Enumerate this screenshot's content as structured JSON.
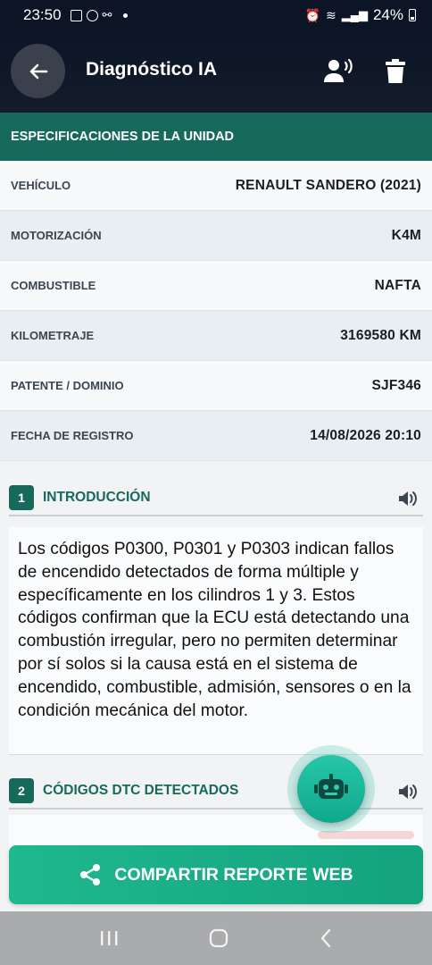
{
  "status_bar": {
    "time": "23:50",
    "battery": "24%"
  },
  "app_bar": {
    "title": "Diagnóstico IA",
    "icons": [
      "arrow-back-icon",
      "voice-person-icon",
      "trash-icon"
    ]
  },
  "specs": {
    "header": "ESPECIFICACIONES DE LA UNIDAD",
    "rows": [
      {
        "label": "VEHÍCULO",
        "value": "RENAULT SANDERO (2021)"
      },
      {
        "label": "MOTORIZACIÓN",
        "value": "K4M"
      },
      {
        "label": "COMBUSTIBLE",
        "value": "NAFTA"
      },
      {
        "label": "KILOMETRAJE",
        "value": "3169580 KM"
      },
      {
        "label": "PATENTE / DOMINIO",
        "value": "SJF346"
      },
      {
        "label": "FECHA DE REGISTRO",
        "value": "14/08/2026 20:10"
      }
    ]
  },
  "sections": [
    {
      "number": "1",
      "title": "INTRODUCCIÓN",
      "body": "Los códigos P0300, P0301 y P0303 indican fallos de encendido detectados de forma múltiple y específicamente en los cilindros 1 y 3. Estos códigos confirman que la ECU está detectando una combustión irregular, pero no permiten determinar por sí solos si la causa está en el sistema de encendido, combustible, admisión, sensores o en la condición mecánica del motor."
    },
    {
      "number": "2",
      "title": "CÓDIGOS DTC DETECTADOS",
      "body": ""
    }
  ],
  "fab": {
    "icon": "robot-icon"
  },
  "share_button": {
    "label": "COMPARTIR REPORTE WEB",
    "icon": "share-icon"
  },
  "colors": {
    "primary": "#17695c",
    "accent": "#1fb88f",
    "appbar": "#0c1526"
  }
}
